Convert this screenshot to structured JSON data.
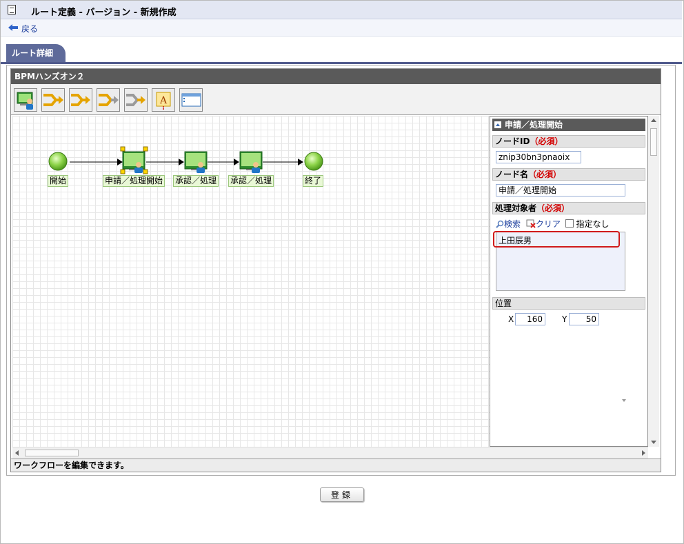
{
  "header": {
    "title": "ルート定義 - バージョン - 新規作成"
  },
  "nav": {
    "back_label": "戻る"
  },
  "tabs": [
    {
      "label": "ルート詳細",
      "active": true
    }
  ],
  "editor": {
    "name": "BPMハンズオン２",
    "toolbar": [
      "user-task-icon",
      "branch-join-icon",
      "branch-arrow-icon",
      "branch-join-gray-icon",
      "branch-arrow-gray-icon",
      "text-icon",
      "window-icon"
    ],
    "nodes": [
      {
        "label": "開始",
        "type": "start"
      },
      {
        "label": "申請／処理開始",
        "type": "task",
        "selected": true
      },
      {
        "label": "承認／処理",
        "type": "task"
      },
      {
        "label": "承認／処理",
        "type": "task"
      },
      {
        "label": "終了",
        "type": "end"
      }
    ],
    "status_message": "ワークフローを編集できます。"
  },
  "panel": {
    "title": "申請／処理開始",
    "node_id": {
      "label": "ノードID",
      "required": "（必須）",
      "value": "znip30bn3pnaoix"
    },
    "node_name": {
      "label": "ノード名",
      "required": "（必須）",
      "value": "申請／処理開始"
    },
    "target": {
      "label": "処理対象者",
      "required": "（必須）",
      "search_label": "検索",
      "clear_label": "クリア",
      "none_label": "指定なし",
      "users": [
        "上田辰男"
      ]
    },
    "position": {
      "label": "位置",
      "x_label": "X",
      "x_value": "160",
      "y_label": "Y",
      "y_value": "50"
    }
  },
  "footer": {
    "submit_label": "登録"
  },
  "colors": {
    "tab": "#5e6a9a",
    "required": "#d40000",
    "highlight": "#d01a1a",
    "node_fill": "#e9f8d6"
  }
}
